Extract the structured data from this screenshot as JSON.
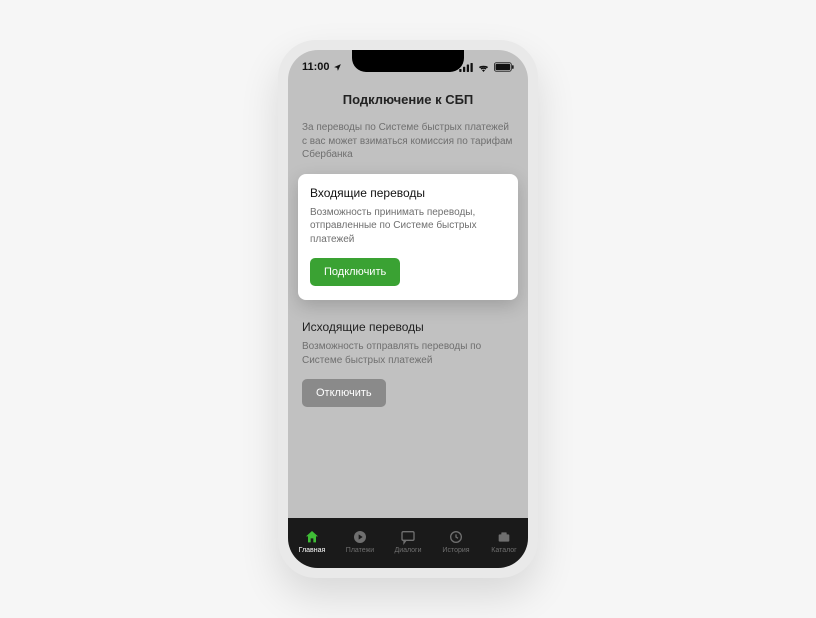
{
  "status": {
    "time": "11:00"
  },
  "page": {
    "title": "Подключение к СБП",
    "info": "За переводы по Системе быстрых платежей с вас может взиматься комиссия по тарифам Сбербанка"
  },
  "incoming": {
    "title": "Входящие переводы",
    "desc": "Возможность принимать переводы, отправленные по Системе быстрых платежей",
    "button": "Подключить"
  },
  "outgoing": {
    "title": "Исходящие переводы",
    "desc": "Возможность отправлять переводы по Системе быстрых платежей",
    "button": "Отключить"
  },
  "tabs": {
    "home": "Главная",
    "payments": "Платежи",
    "dialogs": "Диалоги",
    "history": "История",
    "catalog": "Каталог"
  }
}
